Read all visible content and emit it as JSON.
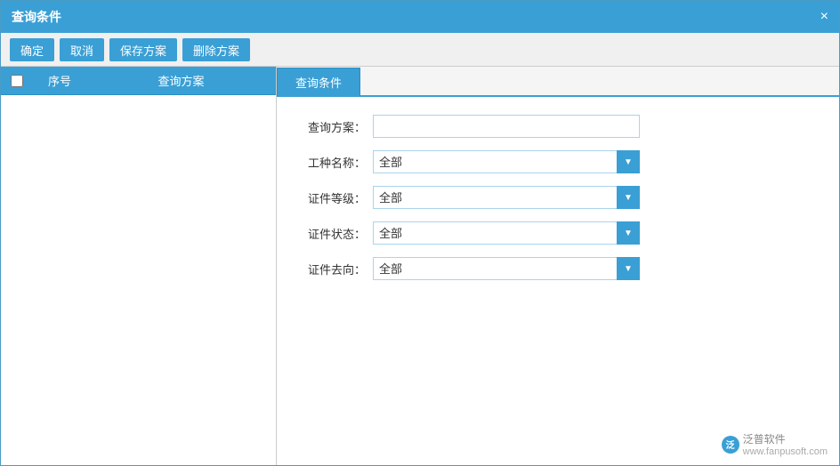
{
  "titleBar": {
    "title": "查询条件",
    "closeLabel": "×"
  },
  "toolbar": {
    "confirmLabel": "确定",
    "cancelLabel": "取消",
    "saveLabel": "保存方案",
    "deleteLabel": "删除方案"
  },
  "leftPanel": {
    "columns": {
      "checkLabel": "",
      "seqLabel": "序号",
      "nameLabel": "查询方案"
    }
  },
  "rightPanel": {
    "tabLabel": "查询条件",
    "form": {
      "fields": [
        {
          "label": "查询方案：",
          "type": "input",
          "value": "",
          "placeholder": ""
        },
        {
          "label": "工种名称：",
          "type": "select",
          "value": "全部",
          "options": [
            "全部"
          ]
        },
        {
          "label": "证件等级：",
          "type": "select",
          "value": "全部",
          "options": [
            "全部"
          ]
        },
        {
          "label": "证件状态：",
          "type": "select",
          "value": "全部",
          "options": [
            "全部"
          ]
        },
        {
          "label": "证件去向：",
          "type": "select",
          "value": "全部",
          "options": [
            "全部"
          ]
        }
      ]
    }
  },
  "watermark": {
    "logoText": "泛",
    "text": "泛普软件",
    "subText": "www.fanpusoft.com"
  }
}
